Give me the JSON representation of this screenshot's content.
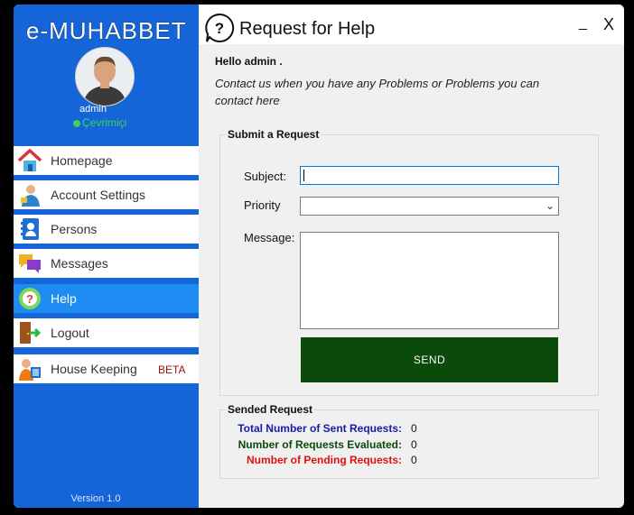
{
  "app": {
    "logo": "e-MUHABBET",
    "version": "Version 1.0"
  },
  "user": {
    "name": "admin",
    "status": "Çevrimiçi"
  },
  "nav": [
    {
      "label": "Homepage",
      "icon": "home-icon"
    },
    {
      "label": "Account Settings",
      "icon": "user-settings-icon"
    },
    {
      "label": "Persons",
      "icon": "contacts-icon"
    },
    {
      "label": "Messages",
      "icon": "messages-icon"
    },
    {
      "label": "Help",
      "icon": "help-icon",
      "active": true
    },
    {
      "label": "Logout",
      "icon": "logout-icon"
    },
    {
      "label": "House Keeping",
      "icon": "housekeeping-icon",
      "badge": "BETA"
    }
  ],
  "header": {
    "title": "Request for Help",
    "minimize": "_",
    "close": "X"
  },
  "intro": {
    "hello": "Hello admin .",
    "contact": "Contact us when you have any Problems or Problems you can contact here"
  },
  "form": {
    "legend": "Submit a Request",
    "subject_label": "Subject:",
    "subject_value": "",
    "priority_label": "Priority",
    "priority_value": "",
    "message_label": "Message:",
    "message_value": "",
    "send_label": "SEND"
  },
  "stats": {
    "legend": "Sended Request",
    "total_label": "Total Number of Sent Requests:",
    "total_value": "0",
    "evaluated_label": "Number of Requests Evaluated:",
    "evaluated_value": "0",
    "pending_label": "Number of Pending Requests:",
    "pending_value": "0"
  },
  "colors": {
    "sidebar": "#1565d8",
    "active_nav": "#1e8cf2",
    "send_button": "#0a4a0a",
    "total": "#1a1aa8",
    "evaluated": "#0a4a0a",
    "pending": "#e01010"
  }
}
